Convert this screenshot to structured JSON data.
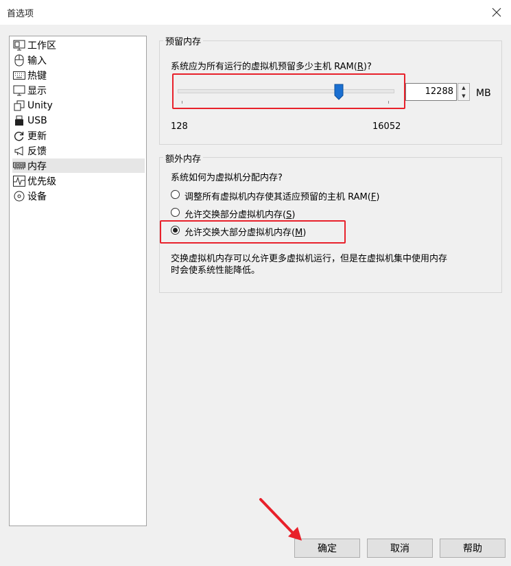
{
  "window": {
    "title": "首选项"
  },
  "sidebar": {
    "items": [
      {
        "label": "工作区",
        "icon": "monitor-window-icon"
      },
      {
        "label": "输入",
        "icon": "mouse-icon"
      },
      {
        "label": "热键",
        "icon": "keyboard-icon"
      },
      {
        "label": "显示",
        "icon": "display-icon"
      },
      {
        "label": "Unity",
        "icon": "unity-windows-icon"
      },
      {
        "label": "USB",
        "icon": "usb-icon"
      },
      {
        "label": "更新",
        "icon": "refresh-icon"
      },
      {
        "label": "反馈",
        "icon": "megaphone-icon"
      },
      {
        "label": "内存",
        "icon": "memory-chip-icon",
        "selected": true
      },
      {
        "label": "优先级",
        "icon": "activity-icon"
      },
      {
        "label": "设备",
        "icon": "disc-icon"
      }
    ]
  },
  "reserved": {
    "title": "预留内存",
    "question_pre": "系统应为所有运行的虚拟机预留多少主机 RAM(",
    "question_key": "R",
    "question_post": ")?",
    "slider_min": "128",
    "slider_max": "16052",
    "value": "12288",
    "unit": "MB"
  },
  "extra": {
    "title": "额外内存",
    "question": "系统如何为虚拟机分配内存?",
    "options": [
      {
        "pre": "调整所有虚拟机内存使其适应预留的主机 RAM(",
        "key": "F",
        "post": ")",
        "checked": false
      },
      {
        "pre": "允许交换部分虚拟机内存(",
        "key": "S",
        "post": ")",
        "checked": false
      },
      {
        "pre": "允许交换大部分虚拟机内存(",
        "key": "M",
        "post": ")",
        "checked": true
      }
    ],
    "note_line1": "交换虚拟机内存可以允许更多虚拟机运行，但是在虚拟机集中使用内存",
    "note_line2": "时会使系统性能降低。"
  },
  "buttons": {
    "ok": "确定",
    "cancel": "取消",
    "help": "帮助"
  },
  "colors": {
    "highlight": "#e8202a",
    "slider_thumb": "#1a6fd1"
  }
}
